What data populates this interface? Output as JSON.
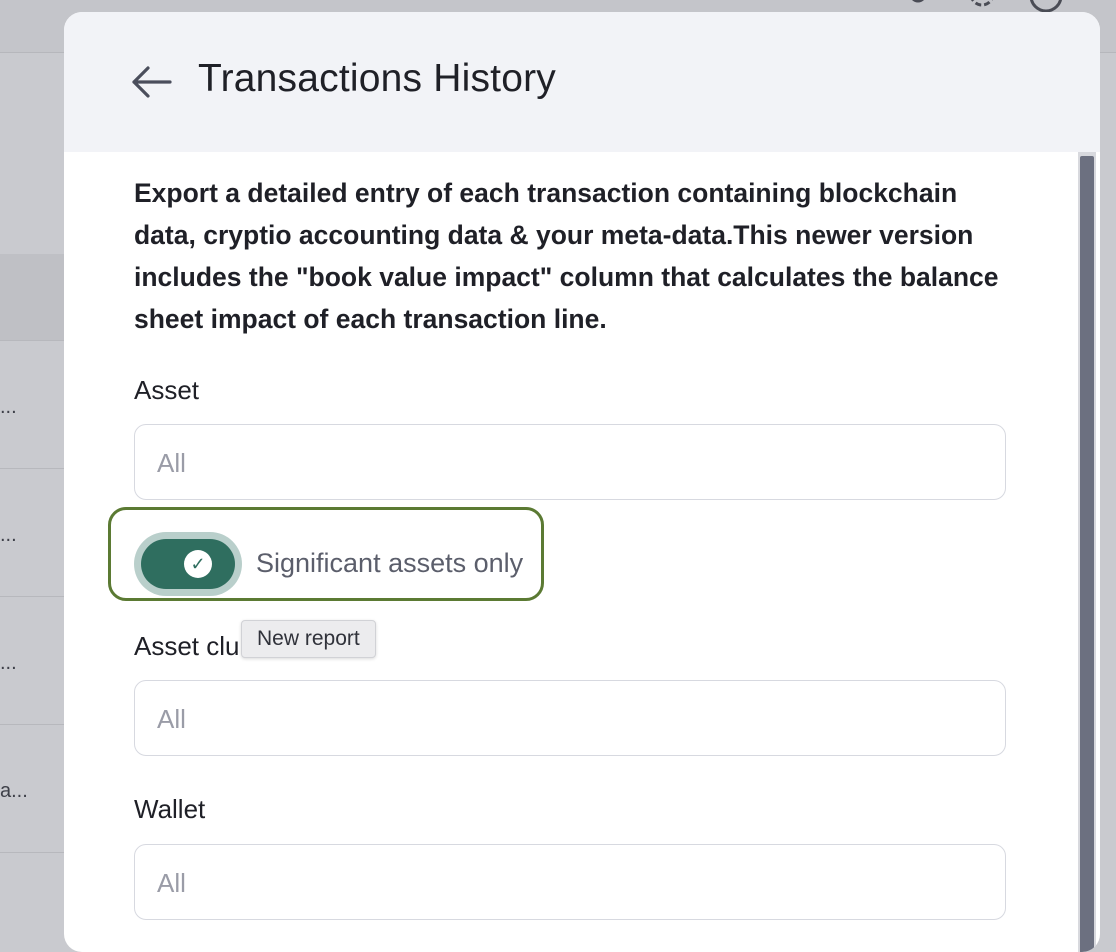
{
  "background": {
    "row_ellipses": [
      "...",
      "...",
      "...",
      "a..."
    ]
  },
  "modal": {
    "title": "Transactions History",
    "description": "Export a detailed entry of each transaction containing blockchain data, cryptio accounting data & your meta-data.This newer version includes the \"book value impact\" column that calculates the balance sheet impact of each transaction line."
  },
  "fields": {
    "asset": {
      "label": "Asset",
      "placeholder": "All"
    },
    "asset_cluster": {
      "label": "Asset clu",
      "placeholder": "All"
    },
    "wallet": {
      "label": "Wallet",
      "placeholder": "All"
    }
  },
  "toggle": {
    "label": "Significant assets only",
    "checked": true,
    "check_glyph": "✓"
  },
  "tooltip": {
    "text": "New report"
  },
  "colors": {
    "toggle_track": "#2f6e5f",
    "focus_ring": "#5b7a33",
    "header_bg": "#f2f3f7"
  },
  "icons": [
    "back-arrow-icon",
    "user-icon",
    "gear-icon",
    "help-icon",
    "check-icon"
  ]
}
